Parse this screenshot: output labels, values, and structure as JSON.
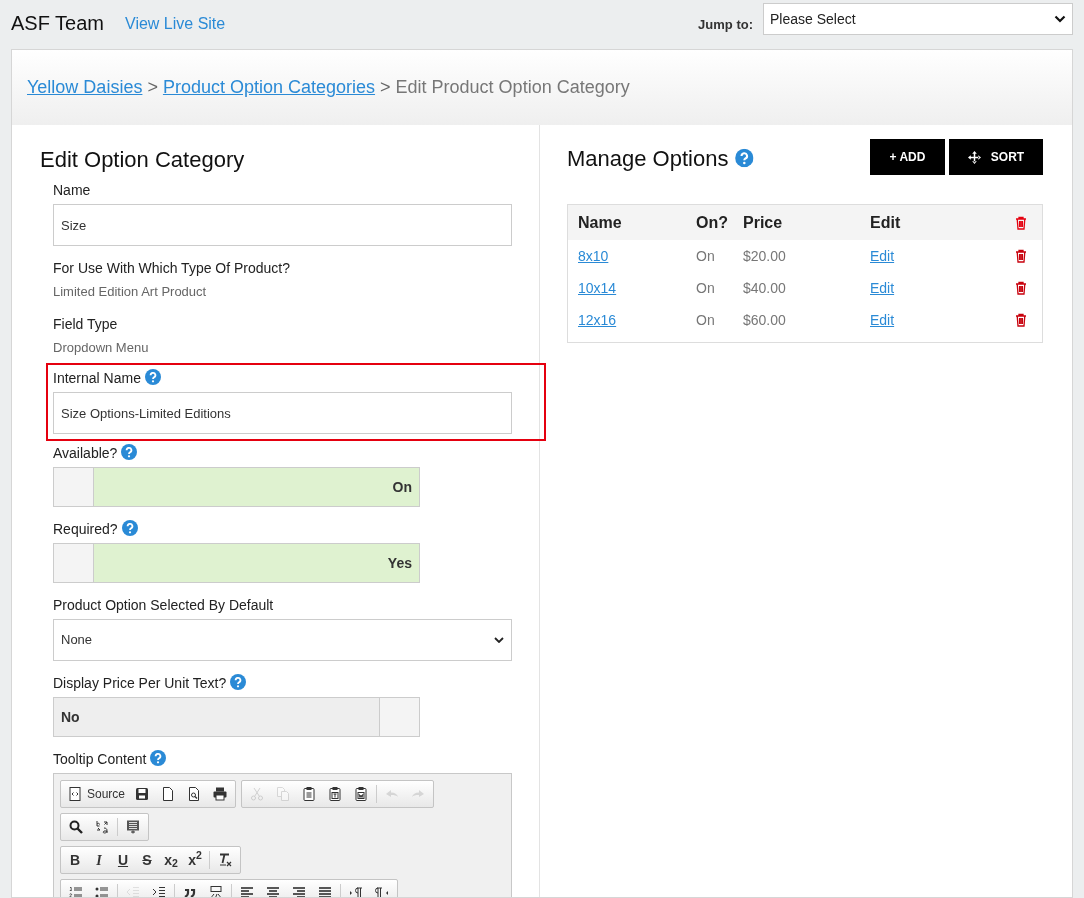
{
  "header": {
    "title": "ASF Team",
    "link": "View Live Site",
    "jump_label": "Jump to:",
    "jump_value": "Please Select"
  },
  "breadcrumb": {
    "links": [
      "Yellow Daisies",
      "Product Option Categories"
    ],
    "separator": ">",
    "current": "Edit Product Option Category"
  },
  "edit_form": {
    "title": "Edit Option Category",
    "fields": [
      {
        "kind": "input",
        "label": "Name",
        "value": "Size",
        "help": false
      },
      {
        "kind": "static",
        "label": "For Use With Which Type Of Product?",
        "value": "Limited Edition Art Product",
        "help": false
      },
      {
        "kind": "static",
        "label": "Field Type",
        "value": "Dropdown Menu",
        "help": false
      },
      {
        "kind": "input",
        "label": "Internal Name",
        "value": "Size Options-Limited Editions",
        "help": true,
        "highlighted": true
      },
      {
        "kind": "toggle",
        "label": "Available?",
        "text": "On",
        "on": true,
        "help": true
      },
      {
        "kind": "toggle",
        "label": "Required?",
        "text": "Yes",
        "on": true,
        "help": true
      },
      {
        "kind": "select",
        "label": "Product Option Selected By Default",
        "value": "None",
        "help": false
      },
      {
        "kind": "toggle",
        "label": "Display Price Per Unit Text?",
        "text": "No",
        "on": false,
        "help": true
      },
      {
        "kind": "editor",
        "label": "Tooltip Content",
        "help": true
      }
    ]
  },
  "editor_toolbar": [
    [
      [
        {
          "kind": "source",
          "label": "Source",
          "disabled": false
        },
        {
          "kind": "save",
          "disabled": false
        },
        {
          "kind": "newpage",
          "disabled": false
        },
        {
          "kind": "preview",
          "disabled": false
        },
        {
          "kind": "print",
          "disabled": false
        }
      ],
      [
        {
          "kind": "cut",
          "disabled": true
        },
        {
          "kind": "copy",
          "disabled": true
        },
        {
          "kind": "paste",
          "disabled": false
        },
        {
          "kind": "pastetext",
          "disabled": false
        },
        {
          "kind": "pasteword",
          "disabled": false
        },
        {
          "kind": "sep"
        },
        {
          "kind": "undo",
          "disabled": true
        },
        {
          "kind": "redo",
          "disabled": true
        }
      ]
    ],
    [
      [
        {
          "kind": "find",
          "disabled": false
        },
        {
          "kind": "replace",
          "disabled": false
        },
        {
          "kind": "sep"
        },
        {
          "kind": "selectall",
          "disabled": false
        }
      ]
    ],
    [
      [
        {
          "kind": "bold",
          "text": "B",
          "disabled": false
        },
        {
          "kind": "italic",
          "text": "I",
          "disabled": false
        },
        {
          "kind": "underline",
          "text": "U",
          "disabled": false
        },
        {
          "kind": "strike",
          "text": "S",
          "disabled": false
        },
        {
          "kind": "subscript",
          "text": "x$_{2}$",
          "disabled": false
        },
        {
          "kind": "superscript",
          "text": "x$^{2}$",
          "disabled": false
        },
        {
          "kind": "sep"
        },
        {
          "kind": "removeformat",
          "disabled": false
        }
      ]
    ],
    [
      [
        {
          "kind": "numlist",
          "disabled": false
        },
        {
          "kind": "bullist",
          "disabled": false
        },
        {
          "kind": "sep"
        },
        {
          "kind": "outdent",
          "disabled": true
        },
        {
          "kind": "indent",
          "disabled": false
        },
        {
          "kind": "sep"
        },
        {
          "kind": "quote",
          "disabled": false
        },
        {
          "kind": "div",
          "disabled": false
        },
        {
          "kind": "sep"
        },
        {
          "kind": "alignleft",
          "disabled": false
        },
        {
          "kind": "aligncenter",
          "disabled": false
        },
        {
          "kind": "alignright",
          "disabled": false
        },
        {
          "kind": "justify",
          "disabled": false
        },
        {
          "kind": "sep"
        },
        {
          "kind": "ltr",
          "disabled": false
        },
        {
          "kind": "rtl",
          "disabled": false
        }
      ]
    ]
  ],
  "manage_options": {
    "title": "Manage Options",
    "buttons": [
      {
        "kind": "add",
        "label": "+ ADD"
      },
      {
        "kind": "sort",
        "label": "SORT"
      }
    ],
    "columns": [
      "Name",
      "On?",
      "Price",
      "Edit"
    ],
    "rows": [
      {
        "name": "8x10",
        "on": "On",
        "price": "$20.00",
        "edit": "Edit"
      },
      {
        "name": "10x14",
        "on": "On",
        "price": "$40.00",
        "edit": "Edit"
      },
      {
        "name": "12x16",
        "on": "On",
        "price": "$60.00",
        "edit": "Edit"
      }
    ]
  }
}
